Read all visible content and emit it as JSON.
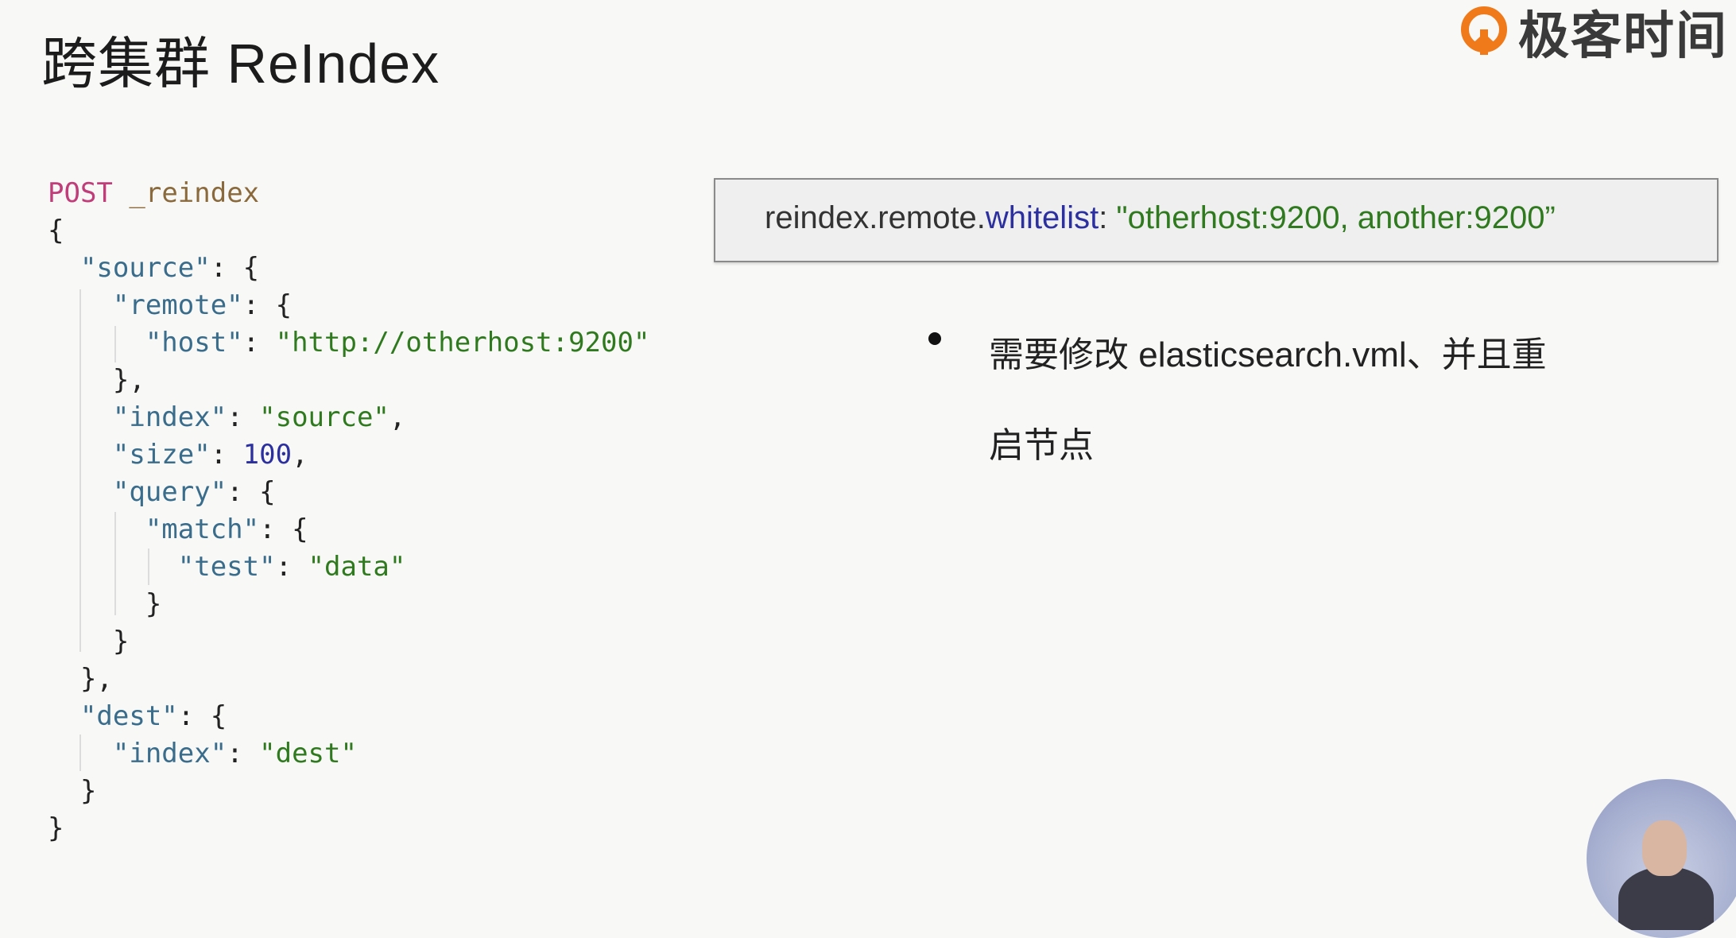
{
  "slide": {
    "title": "跨集群 ReIndex",
    "logo_text": "极客时间"
  },
  "code": {
    "method": "POST",
    "endpoint": "_reindex",
    "k_source": "\"source\"",
    "k_remote": "\"remote\"",
    "k_host": "\"host\"",
    "v_host": "\"http://otherhost:9200\"",
    "k_index": "\"index\"",
    "v_index": "\"source\"",
    "k_size": "\"size\"",
    "v_size": "100",
    "k_query": "\"query\"",
    "k_match": "\"match\"",
    "k_test": "\"test\"",
    "v_test": "\"data\"",
    "k_dest": "\"dest\"",
    "k_dest_index": "\"index\"",
    "v_dest_index": "\"dest\""
  },
  "config": {
    "prefix": "reindex.remote.",
    "keyword": "whitelist",
    "colon": ": ",
    "value": "\"otherhost:9200, another:9200”"
  },
  "note": {
    "line1": "需要修改 elasticsearch.vml、并且重",
    "line2": "启节点"
  },
  "colors": {
    "keyword": "#c03d7a",
    "string": "#2f7a1e",
    "number": "#2b2fa0",
    "key": "#3a6c8c",
    "logo_orange": "#f07a1a"
  }
}
